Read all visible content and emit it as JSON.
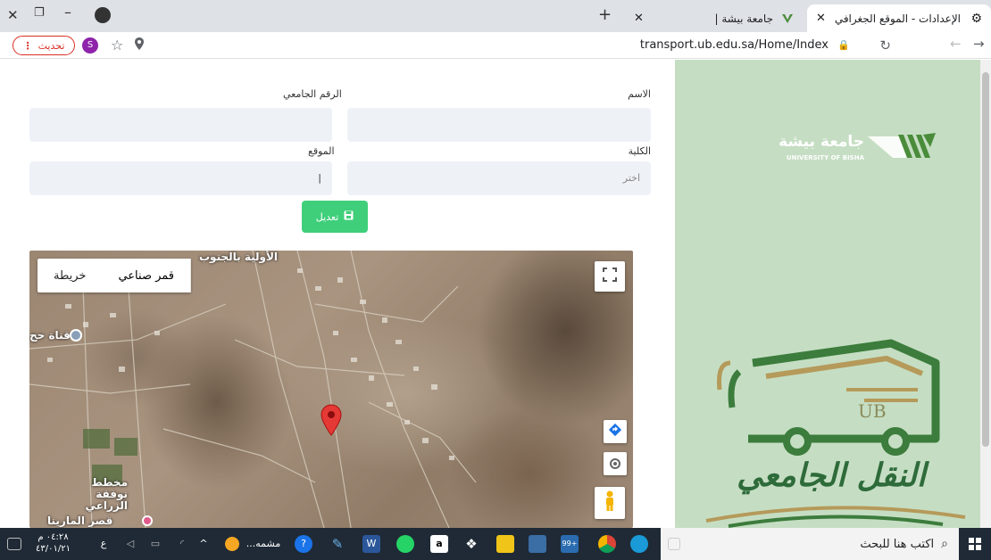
{
  "browser": {
    "tabs": [
      {
        "title": "الإعدادات - الموقع الجغرافي"
      },
      {
        "title": "جامعة بيشة |"
      }
    ],
    "new_tab_icon": "+",
    "url": "transport.ub.edu.sa/Home/Index",
    "update_label": "تحديث",
    "profile_initial": "S"
  },
  "form": {
    "name_label": "الاسم",
    "university_id_label": "الرقم الجامعي",
    "college_label": "الكلية",
    "college_placeholder": "اختر",
    "location_label": "الموقع",
    "location_value": "|",
    "save_label": "تعديل"
  },
  "map": {
    "satellite_label": "قمر صناعي",
    "map_label": "خريطة",
    "places": [
      "قناة حج",
      "مخطط نوفقة الزراعي",
      "قصر المارينا",
      "الأولية بالجنوب"
    ]
  },
  "brand": {
    "logo_arabic": "جامعة بيشة",
    "logo_english": "UNIVERSITY OF BISHA",
    "bus_text": "UB",
    "transport_title": "النقل الجامعي"
  },
  "taskbar": {
    "search_placeholder": "اكتب هنا للبحث",
    "time": "٠٤:٢٨ م",
    "date": "٤٣/٠١/٢١",
    "language": "ع",
    "window_title": "مشمه...",
    "badge_count": "99+"
  },
  "colors": {
    "sidebar": "#c5dec3",
    "save_button": "#3fcf7a",
    "bus_green": "#3c7c3c",
    "bus_gold": "#b59a5a"
  }
}
